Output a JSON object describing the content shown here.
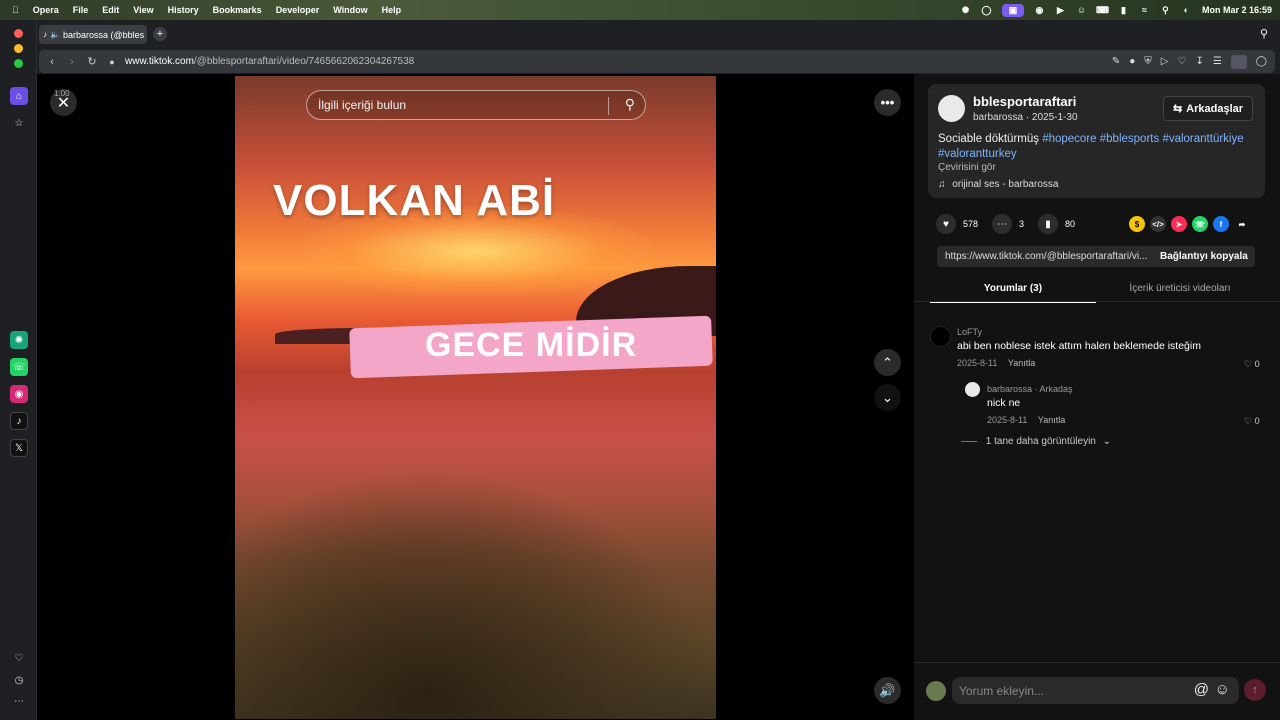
{
  "menubar": {
    "app": "Opera",
    "items": [
      "File",
      "Edit",
      "View",
      "History",
      "Bookmarks",
      "Developer",
      "Window",
      "Help"
    ],
    "datetime": "Mon Mar 2  16:59"
  },
  "browser": {
    "tab_title": "barbarossa (@bbles",
    "url_domain": "www.tiktok.com",
    "url_path": "/@bblesportaraftari/video/7465662062304267538"
  },
  "video": {
    "search_placeholder": "İlgili içeriği bulun",
    "overlay_title": "VOLKAN ABİ",
    "overlay_subtitle": "GECE MİDİR",
    "timecode": "1:00"
  },
  "post": {
    "username": "bblesportaraftari",
    "subline": "barbarossa · 2025-1-30",
    "follow_label": "Arkadaşlar",
    "description_text": "Sociable döktürmüş",
    "hashtags": [
      "#hopecore",
      "#bblesports",
      "#valoranttürkiye",
      "#valorantturkey"
    ],
    "translate": "Çevirisini gör",
    "music": "orijinal ses - barbarossa",
    "likes": "578",
    "comments": "3",
    "saves": "80",
    "link": "https://www.tiktok.com/@bblesportaraftari/vi...",
    "copy_label": "Bağlantıyı kopyala"
  },
  "tabs": {
    "comments": "Yorumlar (3)",
    "creator_videos": "İçerik üreticisi videoları"
  },
  "comments": [
    {
      "author": "LoFTy",
      "text": "abi ben noblese istek attım halen beklemede isteğim",
      "date": "2025-8-11",
      "reply": "Yanıtla",
      "likes": "0"
    },
    {
      "author": "barbarossa · Arkadaş",
      "text": "nick ne",
      "date": "2025-8-11",
      "reply": "Yanıtla",
      "likes": "0"
    }
  ],
  "more_replies": "1 tane daha görüntüleyin",
  "comment_input": {
    "placeholder": "Yorum ekleyin..."
  }
}
